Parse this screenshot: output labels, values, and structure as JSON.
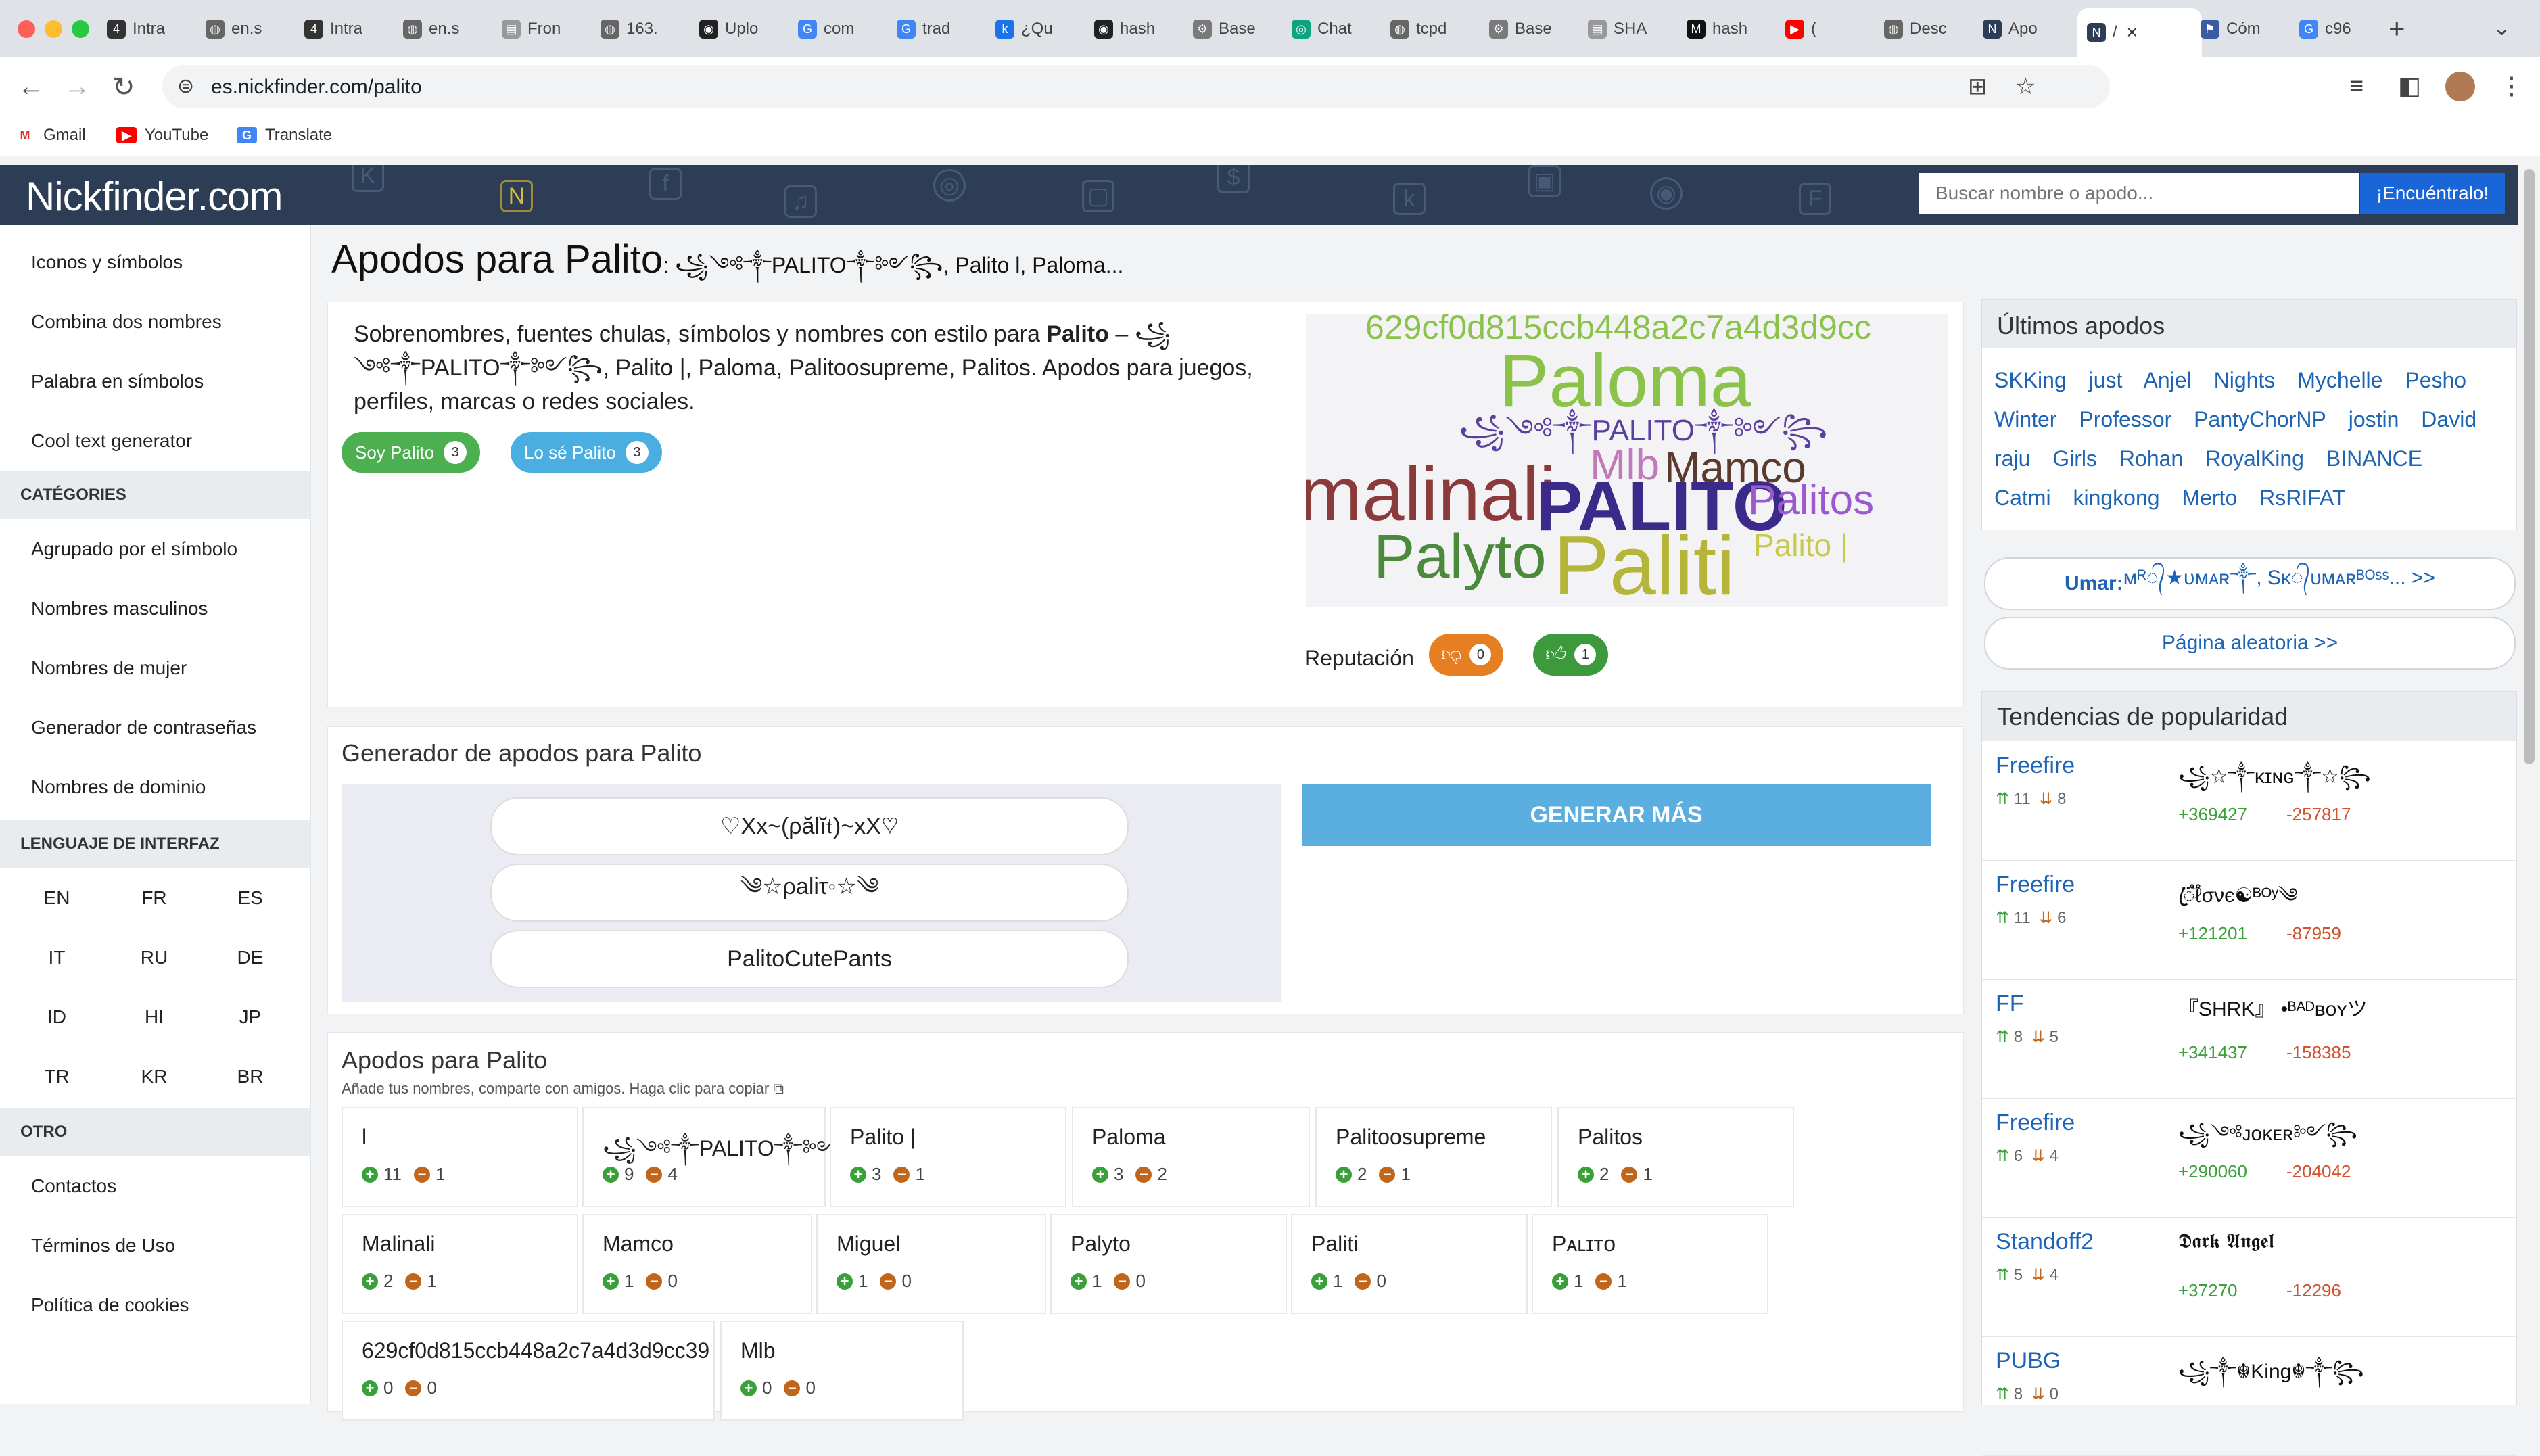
{
  "browser": {
    "tabs": [
      {
        "label": "Intra",
        "icon": "42-icon"
      },
      {
        "label": "en.s",
        "icon": "globe-icon"
      },
      {
        "label": "Intra",
        "icon": "42-icon"
      },
      {
        "label": "en.s",
        "icon": "globe-icon"
      },
      {
        "label": "Fron",
        "icon": "page-icon"
      },
      {
        "label": "163.",
        "icon": "globe-icon"
      },
      {
        "label": "Uplo",
        "icon": "github-icon"
      },
      {
        "label": "com",
        "icon": "google-icon"
      },
      {
        "label": "trad",
        "icon": "google-icon"
      },
      {
        "label": "¿Qu",
        "icon": "k-icon"
      },
      {
        "label": "hash",
        "icon": "github-icon"
      },
      {
        "label": "Base",
        "icon": "gear-icon"
      },
      {
        "label": "Chat",
        "icon": "chatgpt-icon"
      },
      {
        "label": "tcpd",
        "icon": "globe-icon"
      },
      {
        "label": "Base",
        "icon": "gear-icon"
      },
      {
        "label": "SHA",
        "icon": "page-icon"
      },
      {
        "label": "hash",
        "icon": "medium-icon"
      },
      {
        "label": "(",
        "icon": "youtube-icon"
      },
      {
        "label": "Desc",
        "icon": "globe-icon"
      },
      {
        "label": "Apo",
        "icon": "nickfinder-icon"
      }
    ],
    "active_tab": {
      "label": "/"
    },
    "tabs_after": [
      {
        "label": "Cóm",
        "icon": "flag-icon"
      },
      {
        "label": "c96",
        "icon": "google-icon"
      }
    ],
    "url": "es.nickfinder.com/palito",
    "bookmarks": [
      {
        "label": "Gmail",
        "icon": "gmail-icon"
      },
      {
        "label": "YouTube",
        "icon": "youtube-icon"
      },
      {
        "label": "Translate",
        "icon": "translate-icon"
      }
    ]
  },
  "header": {
    "logo": "Nickfinder.com",
    "search_placeholder": "Buscar nombre o apodo...",
    "search_button": "¡Encuéntralo!"
  },
  "sidebar": {
    "top_links": [
      "Iconos y símbolos",
      "Combina dos nombres",
      "Palabra en símbolos",
      "Cool text generator"
    ],
    "categories_head": "CATÉGORIES",
    "category_links": [
      "Agrupado por el símbolo",
      "Nombres masculinos",
      "Nombres de mujer",
      "Generador de contraseñas",
      "Nombres de dominio"
    ],
    "lang_head": "LENGUAJE DE INTERFAZ",
    "languages": [
      "EN",
      "FR",
      "ES",
      "IT",
      "RU",
      "DE",
      "ID",
      "HI",
      "JP",
      "TR",
      "KR",
      "BR"
    ],
    "other_head": "OTRO",
    "other_links": [
      "Contactos",
      "Términos de Uso",
      "Política de cookies"
    ]
  },
  "page": {
    "title": "Apodos para Palito",
    "title_sub": ": ꧁༺༒PALITO༒༻꧂, Palito l, Paloma..."
  },
  "intro": {
    "text_before": "Sobrenombres, fuentes chulas, símbolos y nombres con estilo para ",
    "text_bold": "Palito",
    "text_after": " – ꧁༺༒PALITO༒༻꧂, Palito |, Paloma, Palitoosupreme, Palitos. Apodos para juegos, perfiles, marcas o redes sociales.",
    "btn_soy": "Soy Palito",
    "btn_soy_count": "3",
    "btn_lose": "Lo sé Palito",
    "btn_lose_count": "3",
    "reputation_label": "Reputación",
    "rep_down": "0",
    "rep_up": "1"
  },
  "wordcloud": {
    "words": [
      {
        "text": "629cf0d815ccb448a2c7a4d3d9cc",
        "color": "#8bc34a"
      },
      {
        "text": "Paloma",
        "color": "#8bc34a"
      },
      {
        "text": "꧁༺༒PALITO༒༻꧂",
        "color": "#5a3fa0"
      },
      {
        "text": "Mlb",
        "color": "#c07ab8"
      },
      {
        "text": "Mamco",
        "color": "#5b3a2e"
      },
      {
        "text": "malinali",
        "color": "#8a3a3a"
      },
      {
        "text": "PALITO",
        "color": "#3b2a8a"
      },
      {
        "text": "Palitos",
        "color": "#9b59d0"
      },
      {
        "text": "Palyto",
        "color": "#4a8a3a"
      },
      {
        "text": "Paliti",
        "color": "#b5b53a"
      },
      {
        "text": "Palito |",
        "color": "#c8c84a"
      }
    ]
  },
  "generator": {
    "title": "Generador de apodos para Palito",
    "items": [
      "♡Xx~(ρălĭ𝔱)~xX♡",
      "༄☆ρaliτ◦☆༄",
      "PalitoCutePants"
    ],
    "more_button": "GENERAR MÁS"
  },
  "nicknames": {
    "title": "Apodos para Palito",
    "subtitle": "Añade tus nombres, comparte con amigos. Haga clic para copiar",
    "items": [
      {
        "name": "l",
        "up": "11",
        "down": "1"
      },
      {
        "name": "꧁༺༒PALITO༒༻꧂",
        "up": "9",
        "down": "4"
      },
      {
        "name": "Palito |",
        "up": "3",
        "down": "1"
      },
      {
        "name": "Paloma",
        "up": "3",
        "down": "2"
      },
      {
        "name": "Palitoosupreme",
        "up": "2",
        "down": "1"
      },
      {
        "name": "Palitos",
        "up": "2",
        "down": "1"
      },
      {
        "name": "Malinali",
        "up": "2",
        "down": "1"
      },
      {
        "name": "Mamco",
        "up": "1",
        "down": "0"
      },
      {
        "name": "Miguel",
        "up": "1",
        "down": "0"
      },
      {
        "name": "Palyto",
        "up": "1",
        "down": "0"
      },
      {
        "name": "Paliti",
        "up": "1",
        "down": "0"
      },
      {
        "name": "Pᴀʟɪᴛᴏ",
        "up": "1",
        "down": "1"
      },
      {
        "name": "629cf0d815ccb448a2c7a4d3d9cc39",
        "up": "0",
        "down": "0"
      },
      {
        "name": "Mlb",
        "up": "0",
        "down": "0"
      }
    ]
  },
  "latest": {
    "title": "Últimos apodos",
    "words": [
      "SKKing",
      "just",
      "Anjel",
      "Nights",
      "Mychelle",
      "Pesho",
      "Winter",
      "Professor",
      "PantyChorNP",
      "jostin",
      "David",
      "raju",
      "Girls",
      "Rohan",
      "RoyalKing",
      "BINANCE",
      "Catmi",
      "kingkong",
      "Merto",
      "RsRIFAT"
    ],
    "umar_label": "Umar:",
    "umar_rest": " ᴍᴿ᭄★ᴜᴍᴀʀ༒, Sᴋ᭄ᴜᴍᴀʀᴮᴼˢˢ... >>",
    "random_page": "Página aleatoria >>"
  },
  "trends": {
    "title": "Tendencias de popularidad",
    "rows": [
      {
        "game": "Freefire",
        "up": "11",
        "down": "8",
        "nick": "꧁☆༒ᴋɪɴɢ༒☆꧂",
        "plus": "+369427",
        "minus": "-257817"
      },
      {
        "game": "Freefire",
        "up": "11",
        "down": "6",
        "nick": "ꦿ֟፝ℓσνє☯ᴮᴼʸ༄",
        "plus": "+121201",
        "minus": "-87959"
      },
      {
        "game": "FF",
        "up": "8",
        "down": "5",
        "nick": "『SHRK』 •ᴮᴬᴰʙᴏʏツ",
        "plus": "+341437",
        "minus": "-158385"
      },
      {
        "game": "Freefire",
        "up": "6",
        "down": "4",
        "nick": "꧁༺ᴊᴏᴋᴇʀ༻꧂",
        "plus": "+290060",
        "minus": "-204042"
      },
      {
        "game": "Standoff2",
        "up": "5",
        "down": "4",
        "nick": "𝕯𝖆𝖗𝖐 𝕬𝖓𝖌𝖊𝖑",
        "plus": "+37270",
        "minus": "-12296"
      },
      {
        "game": "PUBG",
        "up": "8",
        "down": "0",
        "nick": "꧁༒☬King☬༒꧂",
        "plus": "",
        "minus": ""
      }
    ]
  },
  "colors": {
    "header_bg": "#2c3d55",
    "search_btn": "#1a66d8",
    "soy_pill": "#4caf50",
    "lose_pill": "#4aaee0",
    "generate_more": "#5aaee0",
    "link_blue": "#1e64b4"
  }
}
